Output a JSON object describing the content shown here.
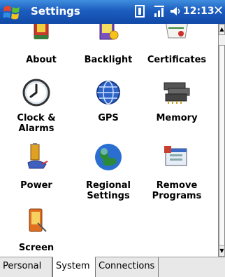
{
  "titlebar": {
    "title": "Settings",
    "time": "12:13",
    "close": "✕",
    "indicators": [
      "connectivity-icon",
      "signal-icon",
      "volume-icon"
    ]
  },
  "items": [
    {
      "label": "About",
      "icon": "about-icon"
    },
    {
      "label": "Backlight",
      "icon": "backlight-icon"
    },
    {
      "label": "Certificates",
      "icon": "certificates-icon"
    },
    {
      "label": "Clock &\nAlarms",
      "icon": "clock-icon"
    },
    {
      "label": "GPS",
      "icon": "gps-icon"
    },
    {
      "label": "Memory",
      "icon": "memory-icon"
    },
    {
      "label": "Power",
      "icon": "power-icon"
    },
    {
      "label": "Regional\nSettings",
      "icon": "globe-icon"
    },
    {
      "label": "Remove\nPrograms",
      "icon": "remove-programs-icon"
    },
    {
      "label": "Screen",
      "icon": "screen-icon"
    }
  ],
  "tabs": [
    {
      "label": "Personal",
      "active": false
    },
    {
      "label": "System",
      "active": true
    },
    {
      "label": "Connections",
      "active": false
    }
  ],
  "colors": {
    "titlebar": "#1c5cbf",
    "globe": "#2a8a3a"
  }
}
